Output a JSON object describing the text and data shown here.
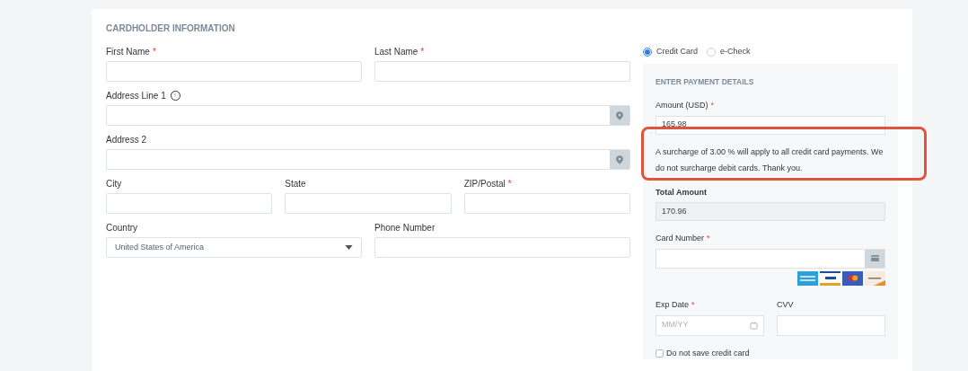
{
  "cardholder": {
    "heading": "CARDHOLDER INFORMATION",
    "fields": [
      {
        "label": "First Name",
        "marker": "*",
        "kind": "text"
      },
      {
        "label": "Last Name",
        "marker": "*",
        "kind": "text"
      },
      {
        "label": "Address Line 1",
        "kind": "address",
        "info": true
      },
      {
        "label": "Address 2",
        "kind": "address"
      },
      {
        "label": "City",
        "kind": "text"
      },
      {
        "label": "State",
        "kind": "text"
      },
      {
        "label": "ZIP/Postal",
        "marker": "*",
        "kind": "text"
      },
      {
        "label": "Country",
        "kind": "select",
        "value": "United States of America"
      },
      {
        "label": "Phone Number",
        "kind": "text"
      }
    ]
  },
  "payment_methods": [
    {
      "label": "Credit Card",
      "selected": true
    },
    {
      "label": "e-Check",
      "selected": false
    }
  ],
  "payment": {
    "heading": "ENTER PAYMENT DETAILS",
    "amount": {
      "label": "Amount (USD)",
      "marker": "*",
      "value": "165.98"
    },
    "surcharge_note": "A surcharge of 3.00 % will apply to all credit card payments. We do not surcharge debit cards. Thank you.",
    "total": {
      "label": "Total Amount",
      "value": "170.96"
    },
    "card_number": {
      "label": "Card Number",
      "marker": "*"
    },
    "card_logos": [
      {
        "kind": "amex"
      },
      {
        "kind": "visa"
      },
      {
        "kind": "mastercard"
      },
      {
        "kind": "discover"
      }
    ],
    "exp_date": {
      "label": "Exp Date",
      "marker": "*",
      "placeholder": "MM/YY"
    },
    "cvv": {
      "label": "CVV"
    },
    "save_card": {
      "label": "Do not save credit card",
      "checked": false
    }
  },
  "highlight": {
    "on": true
  }
}
